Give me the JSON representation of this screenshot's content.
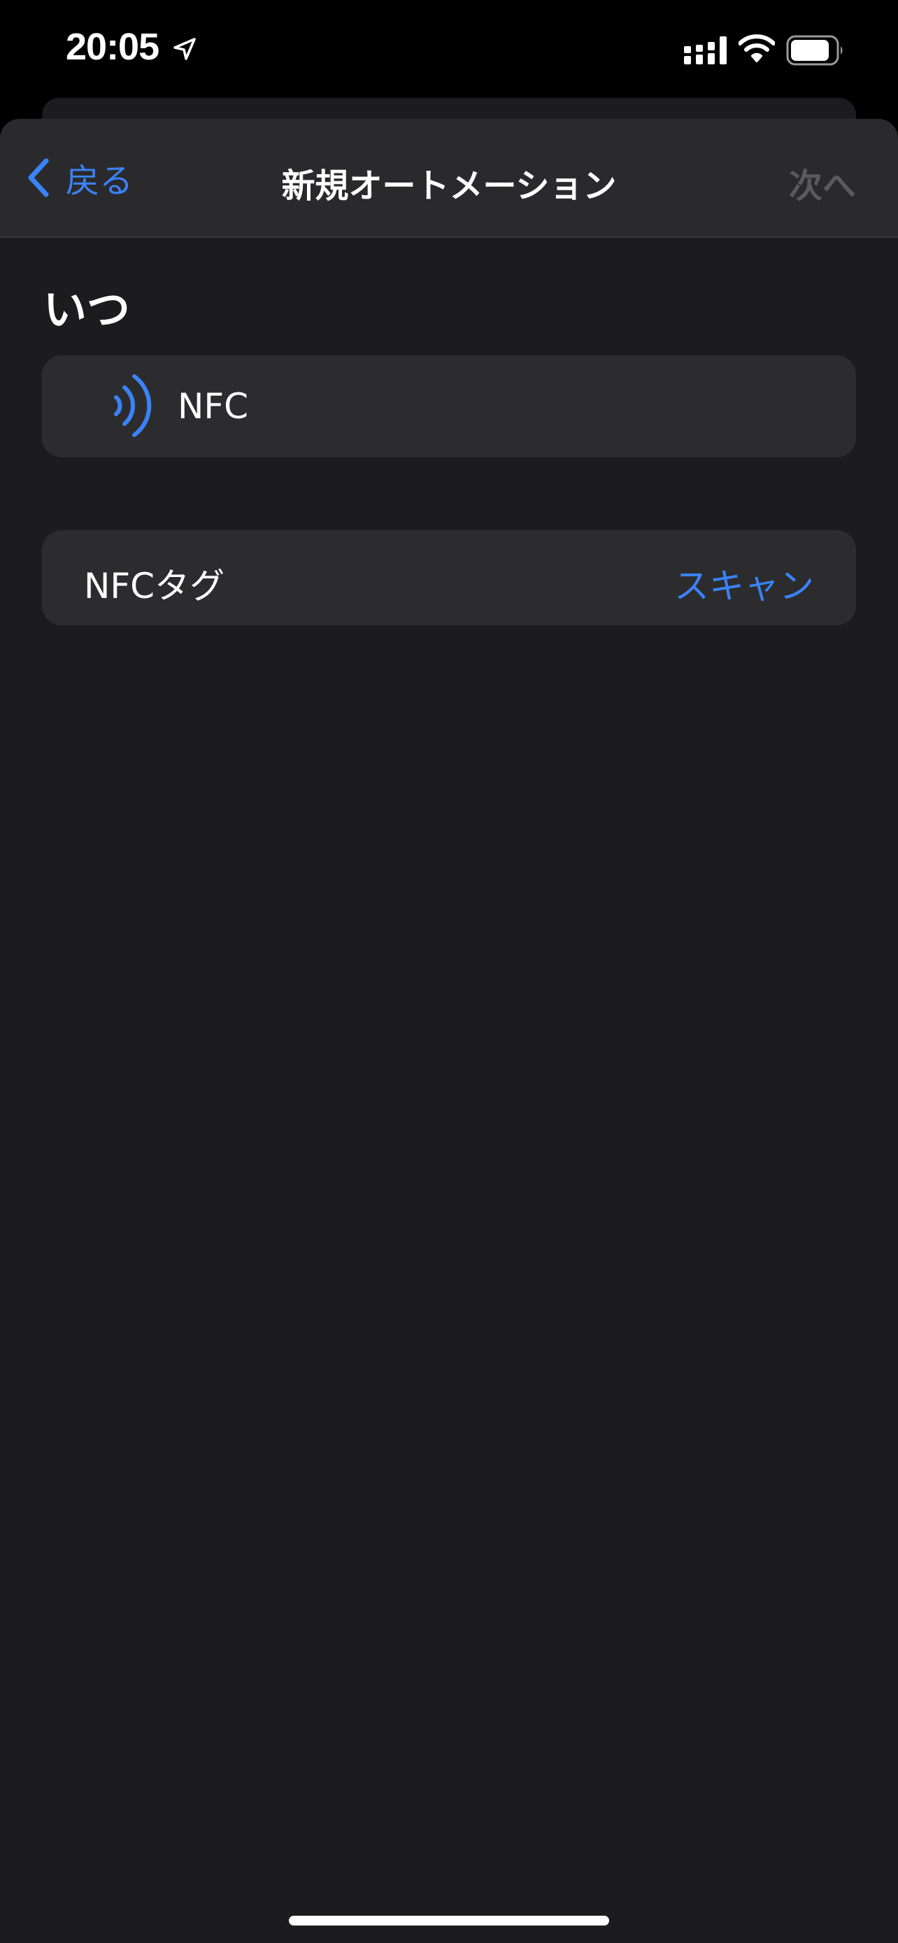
{
  "status_bar": {
    "time": "20:05",
    "icons": [
      "location-arrow-icon",
      "cellular-signal-icon",
      "wifi-icon",
      "battery-icon"
    ]
  },
  "nav": {
    "back_label": "戻る",
    "title": "新規オートメーション",
    "next_label": "次へ"
  },
  "section": {
    "header": "いつ"
  },
  "trigger": {
    "icon": "nfc-icon",
    "label": "NFC"
  },
  "tag": {
    "label": "NFCタグ",
    "action": "スキャン"
  },
  "colors": {
    "accent": "#3b82f6",
    "background": "#1c1c1e",
    "row": "#2c2c2e",
    "disabled": "#5a5a5e"
  }
}
